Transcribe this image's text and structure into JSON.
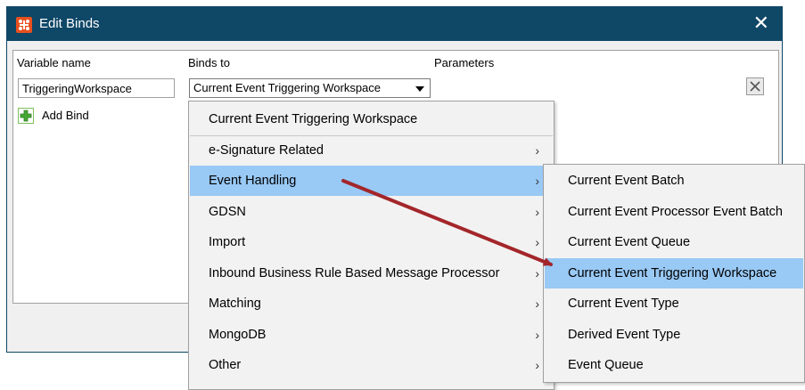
{
  "window": {
    "title": "Edit Binds",
    "icon": "app-logo-icon",
    "close_glyph": "✕"
  },
  "table": {
    "headers": {
      "variable_name": "Variable name",
      "binds_to": "Binds to",
      "parameters": "Parameters"
    },
    "row": {
      "variable_value": "TriggeringWorkspace",
      "binds_to_value": "Current Event Triggering Workspace"
    },
    "add_bind_label": "Add Bind"
  },
  "menu": {
    "items": [
      {
        "label": "Current Event Triggering Workspace",
        "submenu": false
      },
      {
        "label": "e-Signature Related",
        "submenu": true
      },
      {
        "label": "Event Handling",
        "submenu": true,
        "highlighted": true
      },
      {
        "label": "GDSN",
        "submenu": true
      },
      {
        "label": "Import",
        "submenu": true
      },
      {
        "label": "Inbound Business Rule Based Message Processor",
        "submenu": true
      },
      {
        "label": "Matching",
        "submenu": true
      },
      {
        "label": "MongoDB",
        "submenu": true
      },
      {
        "label": "Other",
        "submenu": true
      }
    ],
    "chevron": "›"
  },
  "submenu": {
    "items": [
      {
        "label": "Current Event Batch"
      },
      {
        "label": "Current Event Processor Event Batch"
      },
      {
        "label": "Current Event Queue"
      },
      {
        "label": "Current Event Triggering Workspace",
        "highlighted": true
      },
      {
        "label": "Current Event Type"
      },
      {
        "label": "Derived Event Type"
      },
      {
        "label": "Event Queue"
      }
    ]
  },
  "colors": {
    "titlebar": "#0f4767",
    "highlight": "#99c9f5",
    "annotation_arrow": "#a3262a",
    "logo": "#e8501e"
  }
}
